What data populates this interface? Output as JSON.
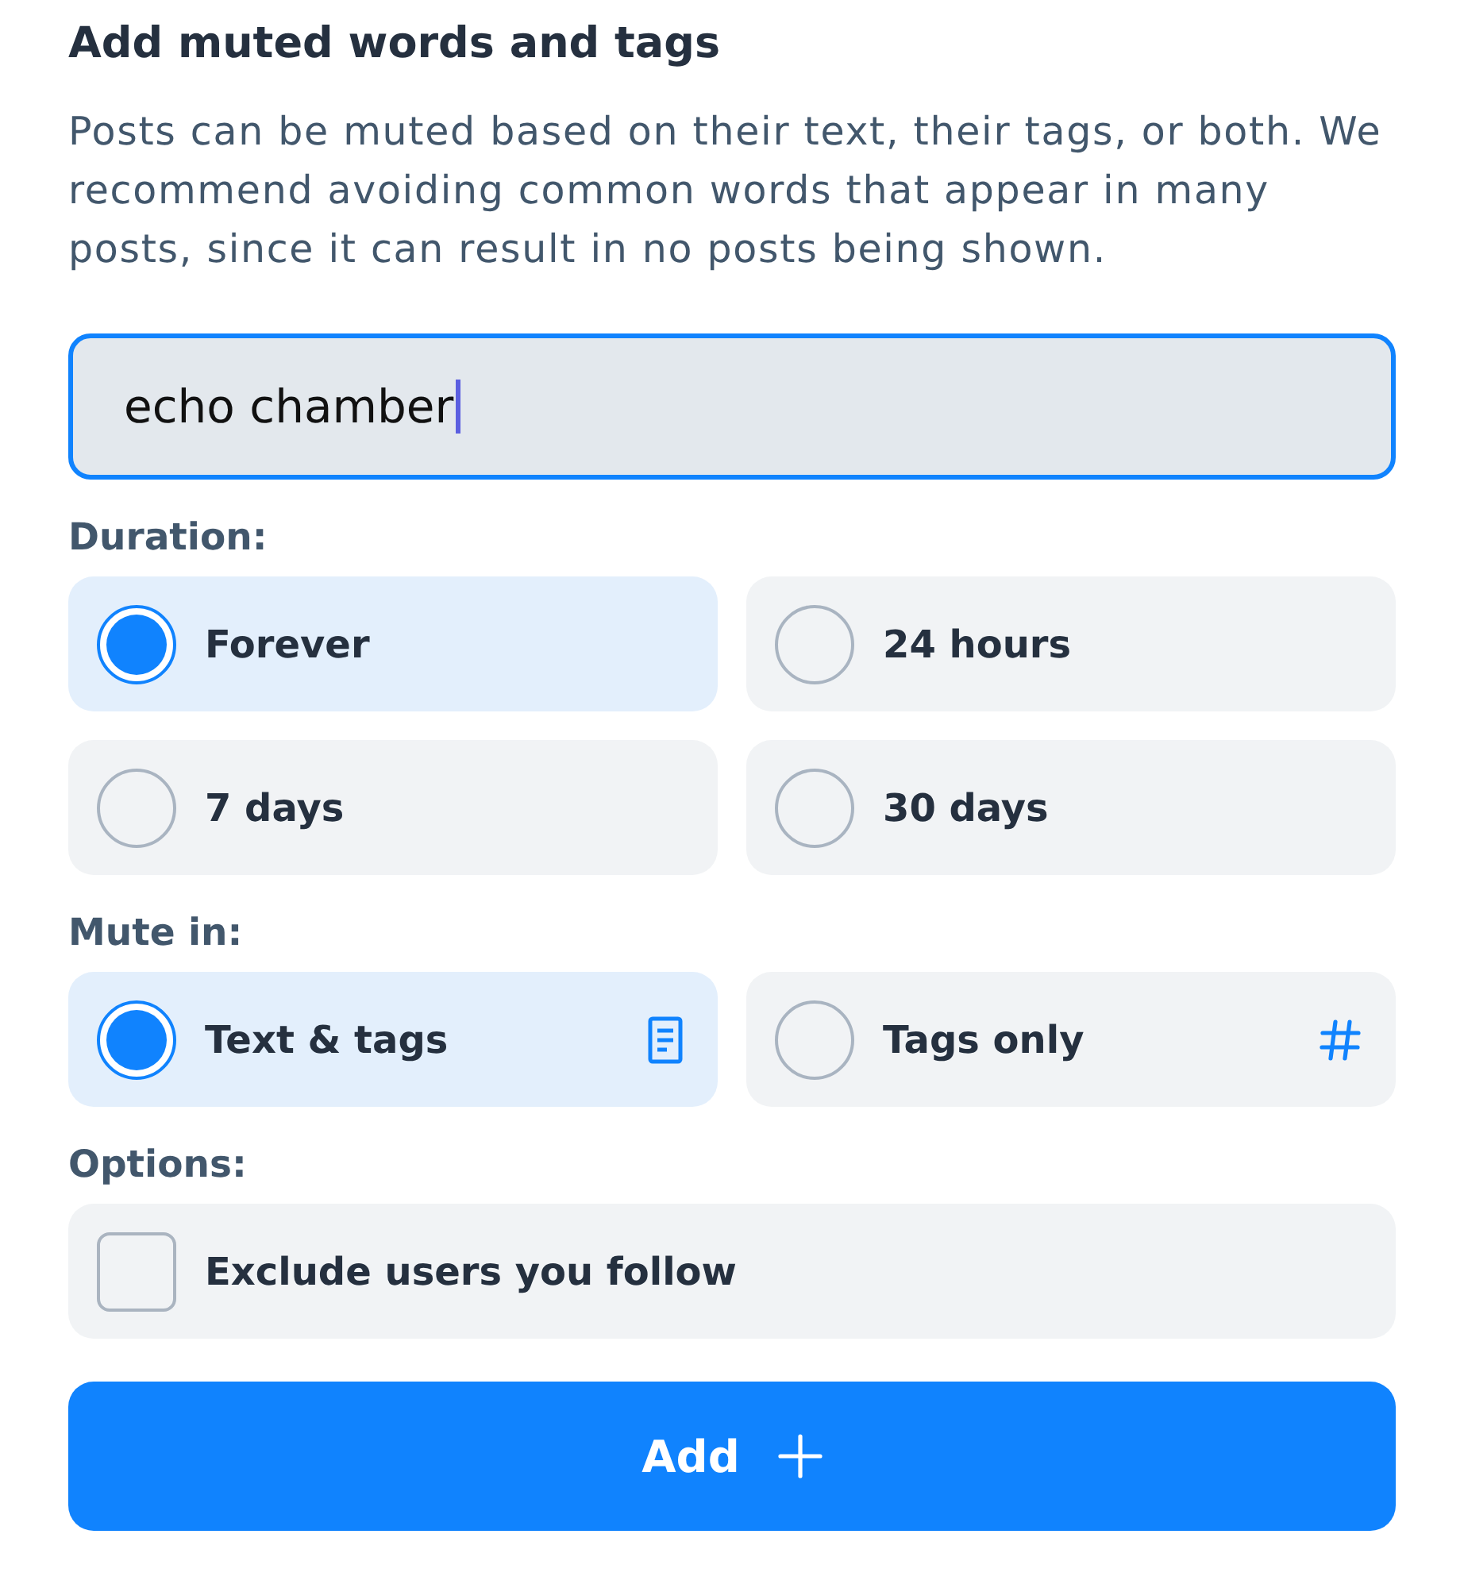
{
  "title": "Add muted words and tags",
  "description": "Posts can be muted based on their text, their tags, or both. We recommend avoiding common words that appear in many posts, since it can result in no posts being shown.",
  "input": {
    "value": "echo chamber",
    "focused": true
  },
  "duration": {
    "label": "Duration:",
    "options": [
      {
        "label": "Forever",
        "selected": true
      },
      {
        "label": "24 hours",
        "selected": false
      },
      {
        "label": "7 days",
        "selected": false
      },
      {
        "label": "30 days",
        "selected": false
      }
    ]
  },
  "mute_in": {
    "label": "Mute in:",
    "options": [
      {
        "label": "Text & tags",
        "kind": "text",
        "selected": true
      },
      {
        "label": "Tags only",
        "kind": "tags",
        "selected": false
      }
    ]
  },
  "options": {
    "label": "Options:",
    "items": [
      {
        "label": "Exclude users you follow",
        "checked": false
      }
    ]
  },
  "add_button": {
    "label": "Add"
  }
}
